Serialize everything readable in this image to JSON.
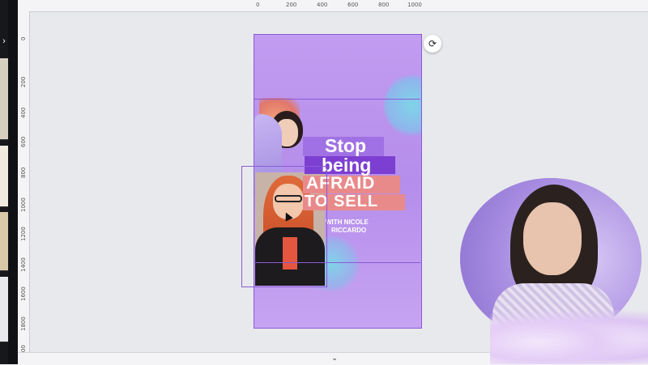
{
  "ruler": {
    "top_ticks": [
      "0",
      "200",
      "400",
      "600",
      "800",
      "1000"
    ],
    "left_ticks": [
      "0",
      "200",
      "400",
      "600",
      "800",
      "1000",
      "1200",
      "1400",
      "1600",
      "1800",
      "2000"
    ]
  },
  "design": {
    "headline_line1": "Stop",
    "headline_line2": "being",
    "headline_line3": "AFRAID",
    "headline_line4": "TO SELL",
    "subline1": "WITH NICOLE",
    "subline2": "RICCARDO"
  },
  "icons": {
    "sidebar_toggle": "chevron-right-icon",
    "panel_handle": "chevron-left-icon",
    "page_nav": "chevron-down-icon",
    "refresh": "refresh-icon"
  },
  "colors": {
    "selection": "#8a5bd6",
    "page_bg": "#b58deb",
    "canvas_bg": "#e8e9ec",
    "highlight_dark": "#7c3fd1",
    "highlight_coral": "#e98a8a"
  }
}
